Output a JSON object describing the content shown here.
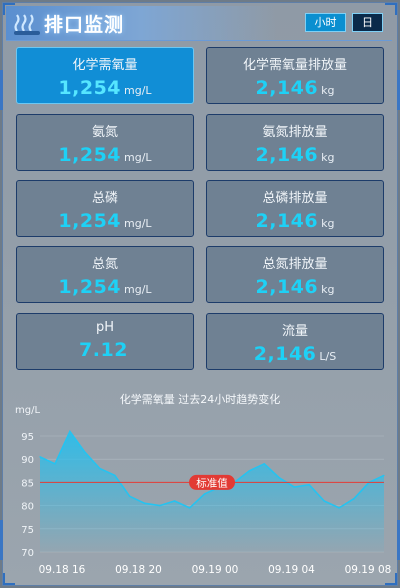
{
  "header": {
    "title": "排口监测",
    "tabs": [
      {
        "label": "小时",
        "active": true
      },
      {
        "label": "日",
        "active": false
      }
    ]
  },
  "cards": [
    {
      "label": "化学需氧量",
      "value": "1,254",
      "unit": "mg/L",
      "active": true
    },
    {
      "label": "化学需氧量排放量",
      "value": "2,146",
      "unit": "kg",
      "active": false
    },
    {
      "label": "氨氮",
      "value": "1,254",
      "unit": "mg/L",
      "active": false
    },
    {
      "label": "氨氮排放量",
      "value": "2,146",
      "unit": "kg",
      "active": false
    },
    {
      "label": "总磷",
      "value": "1,254",
      "unit": "mg/L",
      "active": false
    },
    {
      "label": "总磷排放量",
      "value": "2,146",
      "unit": "kg",
      "active": false
    },
    {
      "label": "总氮",
      "value": "1,254",
      "unit": "mg/L",
      "active": false
    },
    {
      "label": "总氮排放量",
      "value": "2,146",
      "unit": "kg",
      "active": false
    },
    {
      "label": "pH",
      "value": "7.12",
      "unit": "",
      "active": false
    },
    {
      "label": "流量",
      "value": "2,146",
      "unit": "L/S",
      "active": false
    }
  ],
  "chart_data": {
    "type": "area",
    "title": "化学需氧量 过去24小时趋势变化",
    "ylabel": "mg/L",
    "ylim": [
      70,
      95
    ],
    "yticks": [
      70,
      75,
      80,
      85,
      90,
      95
    ],
    "xtick_labels": [
      "09.18 16",
      "09.18 20",
      "09.19 00",
      "09.19 04",
      "09.19 08"
    ],
    "values": [
      90.5,
      89,
      96,
      91.5,
      88,
      86.5,
      82,
      80.5,
      80,
      81,
      79.5,
      82.5,
      84,
      85,
      87.5,
      89,
      86,
      84,
      84.5,
      81,
      79.5,
      81.5,
      85,
      86.5
    ],
    "threshold": {
      "value": 85,
      "label": "标准值",
      "color": "#e23a34"
    },
    "line_color": "#25c3f0",
    "grid": true
  },
  "colors": {
    "accent": "#118ed6",
    "value_text": "#1ed1f6"
  }
}
